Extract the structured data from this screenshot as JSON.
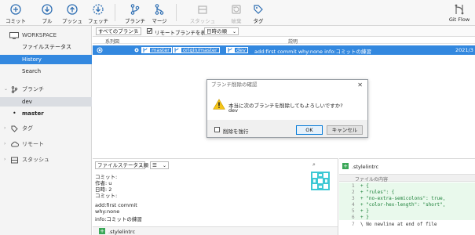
{
  "colors": {
    "accent": "#3388df",
    "diff_added": "#2ea44f",
    "warning": "#f5c518",
    "green": "#3aa757"
  },
  "toolbar": {
    "commit": "コミット",
    "pull": "プル",
    "push": "プッシュ",
    "fetch": "フェッチ",
    "branch": "ブランチ",
    "merge": "マージ",
    "stash": "スタッシュ",
    "discard": "破棄",
    "tag": "タグ",
    "gitflow": "Git Flow",
    "icons": [
      "plus-circle-icon",
      "arrow-down-circle-icon",
      "arrow-up-circle-icon",
      "fetch-circle-icon",
      "branch-icon",
      "merge-icon",
      "stash-icon",
      "discard-icon",
      "tag-icon",
      "gitflow-icon"
    ]
  },
  "sidebar": {
    "workspace": "WORKSPACE",
    "file_status": "ファイルステータス",
    "history": "History",
    "search": "Search",
    "branches": "ブランチ",
    "branch_dev": "dev",
    "branch_master": "master",
    "tags": "タグ",
    "remotes": "リモート",
    "stashes": "スタッシュ"
  },
  "filter": {
    "branches": "すべてのブランチ",
    "show_remote": "リモートブランチを表示",
    "date_order": "日時の順"
  },
  "table": {
    "columns": {
      "graph": "系列図",
      "description": "説明"
    },
    "row": {
      "ref_master": "master",
      "ref_origin": "origin/master",
      "ref_dev": "dev",
      "message": "add:first commit why:none info:コミットの練習",
      "date": "2021/3"
    }
  },
  "dialog": {
    "title": "ブランチ削除の確認",
    "question": "本当に次のブランチを削除してもよろしいですか?",
    "branch": "dev",
    "force": "削除を強行",
    "ok": "OK",
    "cancel": "キャンセル"
  },
  "bottom_left": {
    "mode": "ファイルステータス順",
    "view": "☰",
    "details": [
      "コミット:",
      "作者: u",
      "日時: 2",
      "コミット:"
    ],
    "message": [
      "add:first commit",
      "why:none",
      "info:コミットの練習"
    ],
    "file": ".stylelintrc"
  },
  "bottom_right": {
    "file": ".stylelintrc",
    "header": "ファイルの内容",
    "lines": [
      {
        "no": "1",
        "text": "+ {"
      },
      {
        "no": "2",
        "text": "+   \"rules\": {"
      },
      {
        "no": "3",
        "text": "+     \"no-extra-semicolons\": true,"
      },
      {
        "no": "4",
        "text": "+     \"color-hex-length\": \"short\","
      },
      {
        "no": "5",
        "text": "+   }"
      },
      {
        "no": "6",
        "text": "+ }"
      },
      {
        "no": "7",
        "text": "\\ No newline at end of file"
      }
    ]
  }
}
